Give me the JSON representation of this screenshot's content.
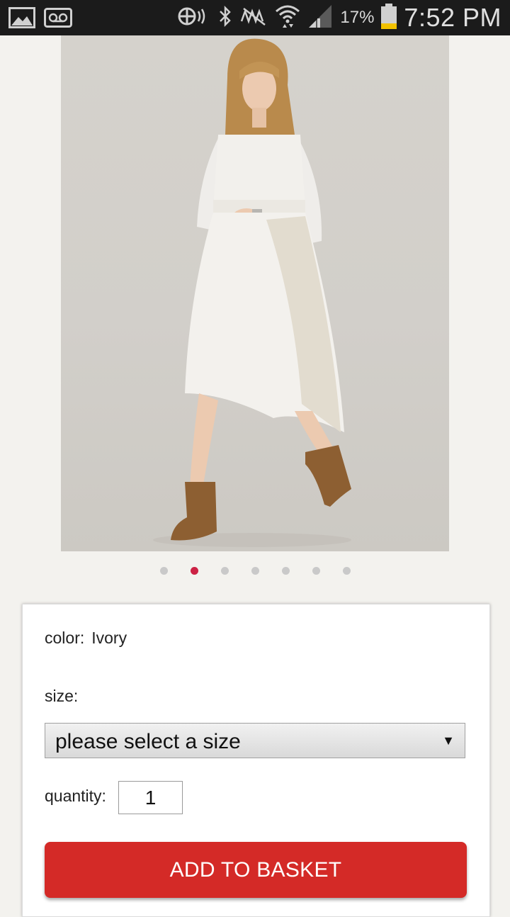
{
  "status_bar": {
    "icons_left": [
      "gallery-icon",
      "voicemail-icon"
    ],
    "icons_right": [
      "nfc-icon",
      "bluetooth-icon",
      "mute-icon",
      "wifi-icon",
      "signal-icon",
      "battery-icon"
    ],
    "battery_percent": "17%",
    "time": "7:52 PM"
  },
  "product": {
    "image_alt": "model in ivory dress with brown ankle boots",
    "carousel": {
      "total": 7,
      "active_index": 1
    }
  },
  "options": {
    "color_label": "color:",
    "color_value": "Ivory",
    "size_label": "size:",
    "size_select_text": "please select a size",
    "quantity_label": "quantity:",
    "quantity_value": "1",
    "add_button_label": "ADD TO BASKET"
  },
  "colors": {
    "accent": "#d42a27",
    "dot_active": "#cc2244"
  }
}
